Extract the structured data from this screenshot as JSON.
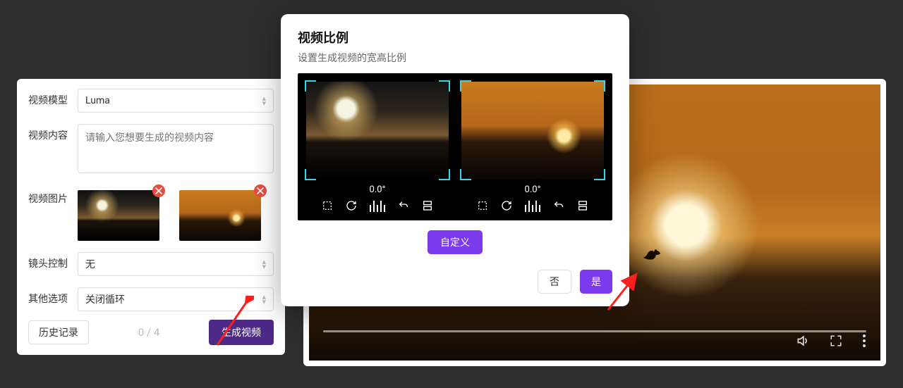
{
  "form": {
    "model_label": "视频模型",
    "model_value": "Luma",
    "content_label": "视频内容",
    "content_placeholder": "请输入您想要生成的视频内容",
    "image_label": "视频图片",
    "camera_label": "镜头控制",
    "camera_value": "无",
    "other_label": "其他选项",
    "other_value": "关闭循环",
    "history_button": "历史记录",
    "counter_current": "0",
    "counter_sep": " / ",
    "counter_total": "4",
    "generate_button": "生成视频"
  },
  "modal": {
    "title": "视频比例",
    "subtitle": "设置生成视频的宽高比例",
    "ratio_a": "0.0°",
    "ratio_b": "0.0°",
    "custom_button": "自定义",
    "no_button": "否",
    "yes_button": "是"
  },
  "colors": {
    "accent": "#7c3aed",
    "corner": "#34d6e7",
    "danger": "#e74c3c"
  }
}
